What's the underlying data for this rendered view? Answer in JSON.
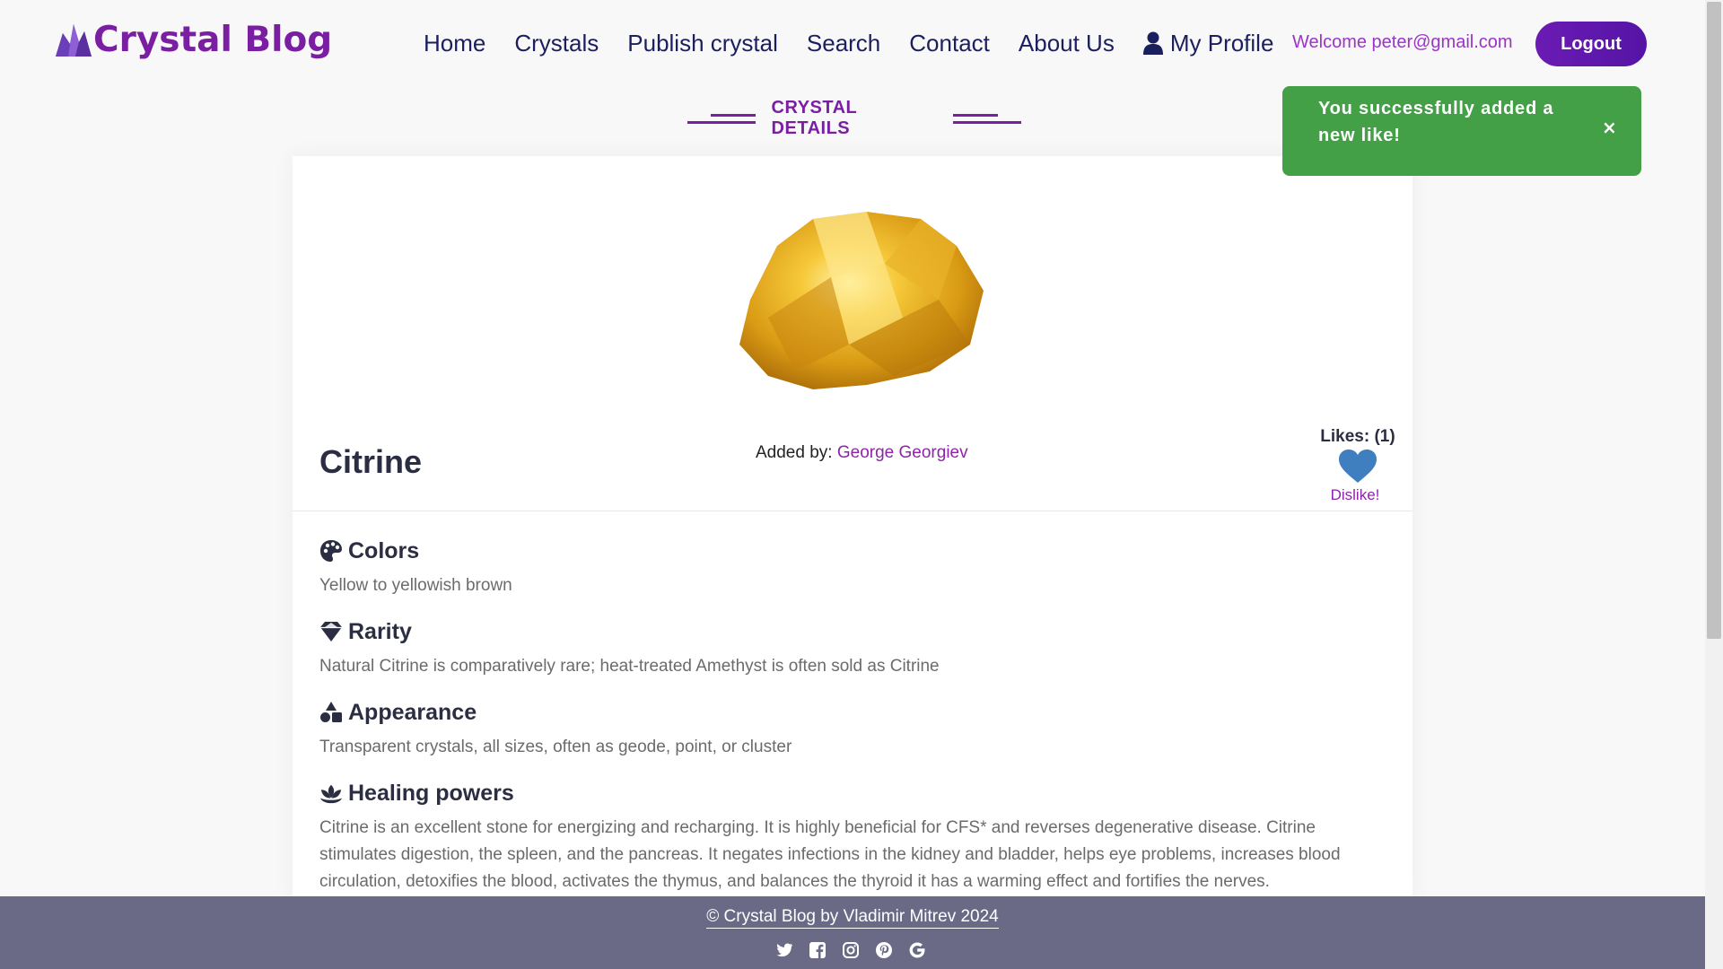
{
  "header": {
    "brand": "Crystal Blog",
    "nav": {
      "home": "Home",
      "crystals": "Crystals",
      "publish": "Publish crystal",
      "search": "Search",
      "contact": "Contact",
      "about": "About Us",
      "profile": "My Profile"
    },
    "welcome": "Welcome peter@gmail.com",
    "logout": "Logout"
  },
  "section": {
    "title": "CRYSTAL DETAILS"
  },
  "crystal": {
    "name": "Citrine",
    "added_by_label": "Added by:",
    "author": "George Georgiev",
    "likes_label": "Likes: (1)",
    "dislike_label": "Dislike!",
    "details": {
      "colors": {
        "title": "Colors",
        "text": "Yellow to yellowish brown"
      },
      "rarity": {
        "title": "Rarity",
        "text": "Natural Citrine is comparatively rare; heat-treated Amethyst is often sold as Citrine"
      },
      "appearance": {
        "title": "Appearance",
        "text": "Transparent crystals, all sizes, often as geode, point, or cluster"
      },
      "healing": {
        "title": "Healing powers",
        "text": "Citrine is an excellent stone for energizing and recharging. It is highly beneficial for CFS* and reverses degenerative disease. Citrine stimulates digestion, the spleen, and the pancreas. It negates infections in the kidney and bladder, helps eye problems, increases blood circulation, detoxifies the blood, activates the thymus, and balances the thyroid it has a warming effect and fortifies the nerves."
      }
    }
  },
  "toast": {
    "message": "You successfully added a new like!",
    "close": "×"
  },
  "footer": {
    "copyright": "© Crystal Blog by Vladimir Mitrev 2024",
    "social_icons": [
      "twitter-icon",
      "facebook-icon",
      "instagram-icon",
      "pinterest-icon",
      "google-icon"
    ]
  },
  "colors": {
    "brand_purple": "#7b1fa2",
    "nav_text": "#1c1f5e",
    "toast_green": "#43a047",
    "heart_blue": "#3f7fbf",
    "footer_bg": "#6b6a86"
  }
}
